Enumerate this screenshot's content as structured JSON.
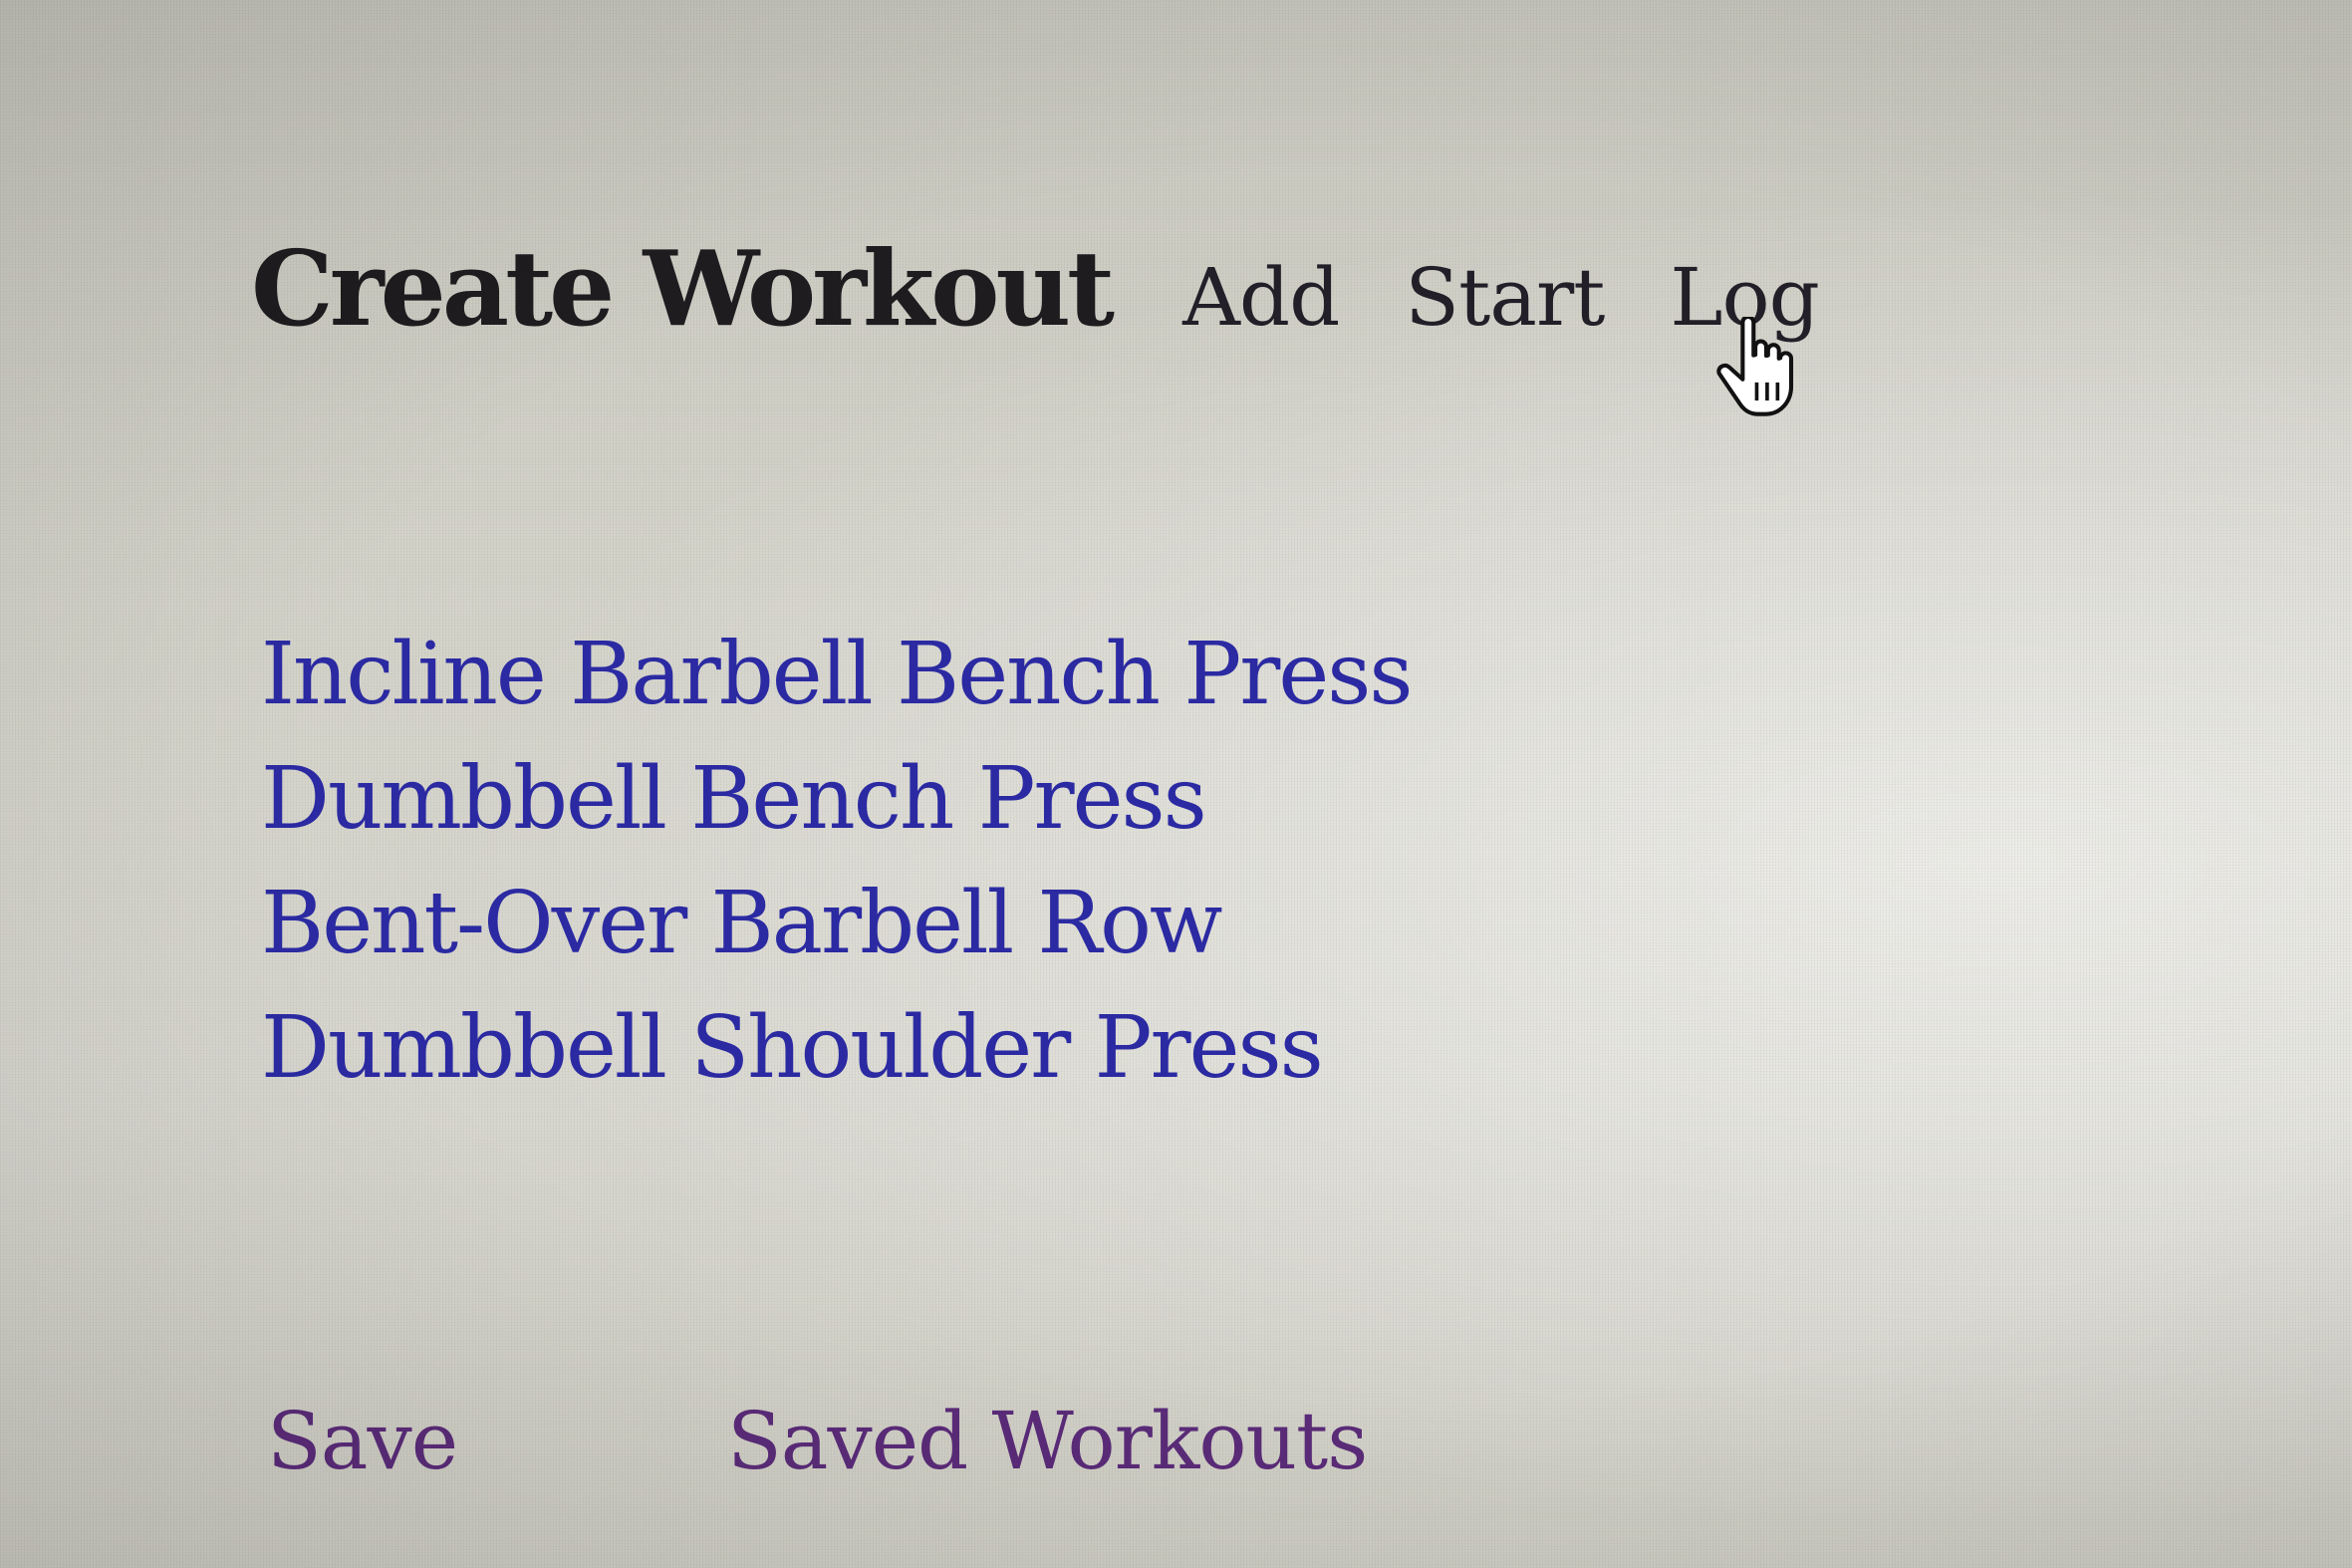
{
  "nav": {
    "title": "Create Workout",
    "links": [
      "Add",
      "Start",
      "Log"
    ]
  },
  "exercises": [
    "Incline Barbell Bench Press",
    "Dumbbell Bench Press",
    "Bent-Over Barbell Row",
    "Dumbbell Shoulder Press"
  ],
  "footer": {
    "save_label": "Save",
    "saved_workouts_label": "Saved Workouts"
  },
  "colors": {
    "title": "#1e1c1f",
    "nav_link": "#221f28",
    "exercise_link": "#2b2aa2",
    "visited_link": "#5a2b78",
    "background": "#d4d3ca"
  },
  "cursor": "hand-pointer-icon"
}
